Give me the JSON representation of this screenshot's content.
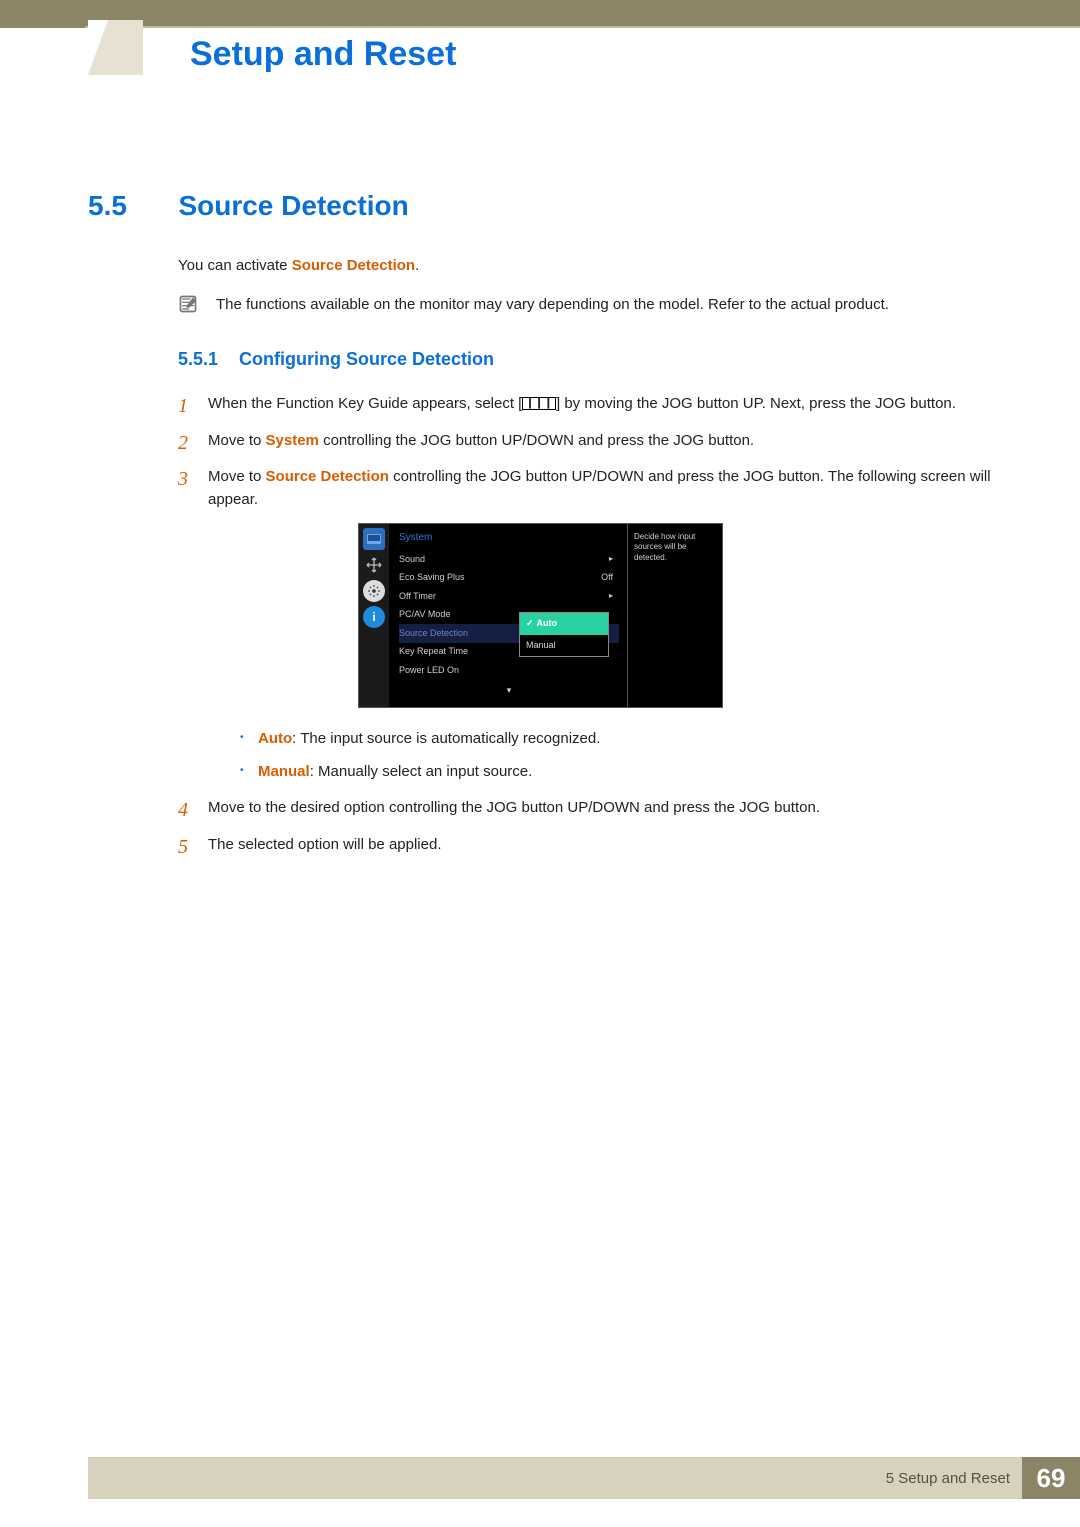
{
  "header": {
    "chapter_title": "Setup and Reset"
  },
  "section": {
    "number": "5.5",
    "title": "Source Detection"
  },
  "intro": {
    "prefix": "You can activate ",
    "term": "Source Detection",
    "suffix": "."
  },
  "note": "The functions available on the monitor may vary depending on the model. Refer to the actual product.",
  "subsection": {
    "number": "5.5.1",
    "title": "Configuring Source Detection"
  },
  "steps": {
    "s1a": "When the Function Key Guide appears, select [",
    "s1b": "] by moving the JOG button UP. Next, press the JOG button.",
    "menu_glyph": "❙❙❙",
    "s2a": "Move to ",
    "s2_system": "System",
    "s2b": " controlling the JOG button UP/DOWN and press the JOG button.",
    "s3a": "Move to ",
    "s3_term": "Source Detection",
    "s3b": " controlling the JOG button UP/DOWN and press the JOG button. The following screen will appear.",
    "s4": "Move to the desired option controlling the JOG button UP/DOWN and press the JOG button.",
    "s5": "The selected option will be applied."
  },
  "osd": {
    "title": "System",
    "items": [
      {
        "label": "Sound",
        "value": "",
        "arrow": true
      },
      {
        "label": "Eco Saving Plus",
        "value": "Off",
        "arrow": false
      },
      {
        "label": "Off Timer",
        "value": "",
        "arrow": true
      },
      {
        "label": "PC/AV Mode",
        "value": "",
        "arrow": false
      }
    ],
    "selected": "Source Detection",
    "after": [
      {
        "label": "Key Repeat Time"
      },
      {
        "label": "Power LED On"
      }
    ],
    "dropdown": {
      "active": "Auto",
      "other": "Manual"
    },
    "tooltip": "Decide how input sources will be detected.",
    "info_glyph": "i"
  },
  "bullets": {
    "auto_term": "Auto",
    "auto_desc": ": The input source is automatically recognized.",
    "manual_term": "Manual",
    "manual_desc": ": Manually select an input source."
  },
  "footer": {
    "chapter": "5 Setup and Reset",
    "page": "69"
  }
}
